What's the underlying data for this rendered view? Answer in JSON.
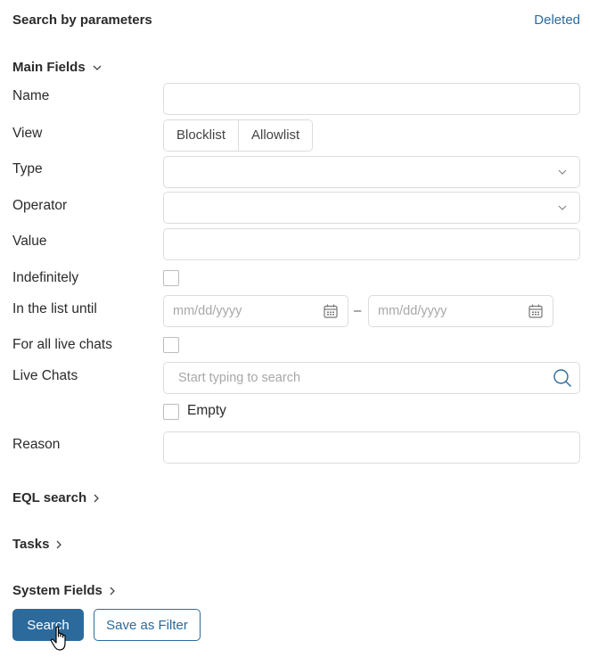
{
  "header": {
    "title": "Search by parameters",
    "deleted_link": "Deleted"
  },
  "sections": {
    "main_fields": "Main Fields",
    "eql_search": "EQL search",
    "tasks": "Tasks",
    "system_fields": "System Fields"
  },
  "fields": {
    "name": {
      "label": "Name",
      "value": ""
    },
    "view": {
      "label": "View",
      "options": [
        "Blocklist",
        "Allowlist"
      ]
    },
    "type": {
      "label": "Type",
      "value": ""
    },
    "operator": {
      "label": "Operator",
      "value": ""
    },
    "value": {
      "label": "Value",
      "value": ""
    },
    "indefinitely": {
      "label": "Indefinitely",
      "checked": false
    },
    "in_list_until": {
      "label": "In the list until",
      "from_placeholder": "mm/dd/yyyy",
      "to_placeholder": "mm/dd/yyyy",
      "separator": "–"
    },
    "for_all_live_chats": {
      "label": "For all live chats",
      "checked": false
    },
    "live_chats": {
      "label": "Live Chats",
      "placeholder": "Start typing to search",
      "empty_label": "Empty",
      "empty_checked": false
    },
    "reason": {
      "label": "Reason",
      "value": ""
    }
  },
  "actions": {
    "search": "Search",
    "save_as_filter": "Save as Filter"
  },
  "colors": {
    "accent": "#2c6a9c",
    "border": "#dcdcdc",
    "placeholder": "#a8a8a8"
  }
}
